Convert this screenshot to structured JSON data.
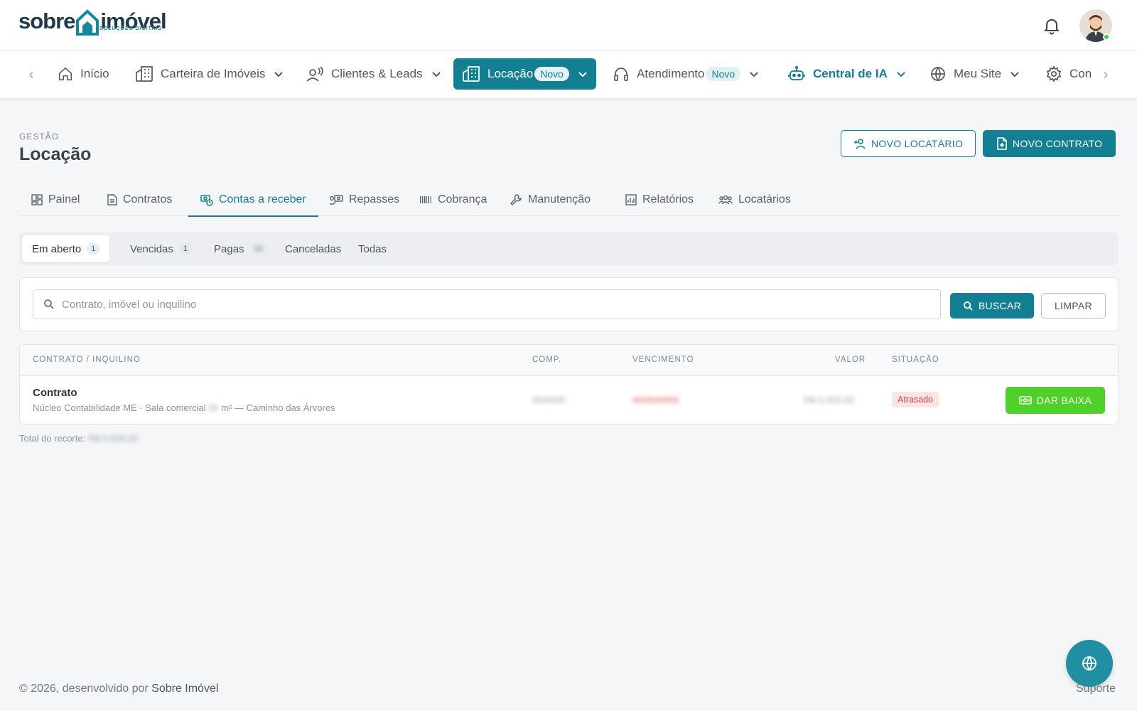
{
  "brand": {
    "name_left": "sobre",
    "name_right": "imóvel",
    "tagline": "SOLUÇÕES DIGITAIS",
    "primary_color": "#137f92",
    "success_color": "#4fd12a",
    "danger_color": "#d64545"
  },
  "header": {
    "notifications_icon": "bell-icon",
    "avatar_alt": "user-avatar"
  },
  "nav": {
    "items": [
      {
        "label": "Início",
        "icon": "home-icon"
      },
      {
        "label": "Carteira de Imóveis",
        "icon": "building-icon"
      },
      {
        "label": "Clientes & Leads",
        "icon": "people-icon"
      },
      {
        "label": "Locação",
        "badge": "Novo",
        "icon": "building-icon"
      },
      {
        "label": "Atendimento",
        "badge": "Novo",
        "icon": "headset-icon"
      },
      {
        "label": "Central de IA",
        "icon": "robot-icon"
      },
      {
        "label": "Meu Site",
        "icon": "globe-icon"
      },
      {
        "label": "Con",
        "icon": "gear-icon"
      }
    ]
  },
  "page": {
    "eyebrow": "GESTÃO",
    "title": "Locação",
    "btn_new_tenant": "NOVO LOCATÁRIO",
    "btn_new_contract": "NOVO CONTRATO"
  },
  "tabs": [
    {
      "label": "Painel"
    },
    {
      "label": "Contratos"
    },
    {
      "label": "Contas a receber"
    },
    {
      "label": "Repasses"
    },
    {
      "label": "Cobrança"
    },
    {
      "label": "Manutenção"
    },
    {
      "label": "Relatórios"
    },
    {
      "label": "Locatários"
    }
  ],
  "filters": [
    {
      "label": "Em aberto",
      "count": "1"
    },
    {
      "label": "Vencidas",
      "count": "1"
    },
    {
      "label": "Pagas",
      "count": "10"
    },
    {
      "label": "Canceladas"
    },
    {
      "label": "Todas"
    }
  ],
  "search": {
    "placeholder": "Contrato, imóvel ou inquilino",
    "value": "",
    "btn_search": "BUSCAR",
    "btn_clear": "LIMPAR"
  },
  "table": {
    "columns": {
      "contract": "CONTRATO / INQUILINO",
      "comp": "COMP.",
      "due": "VENCIMENTO",
      "value": "VALOR",
      "status": "SITUAÇÃO"
    },
    "rows": [
      {
        "title": "Contrato",
        "sub_prefix": "Núcleo Contabilidade ME · Sala comercial ",
        "sub_area": "00",
        "sub_suffix": " m² — Caminho das Árvores",
        "comp": "00/0000",
        "due": "00/00/0000",
        "value": "R$ 0.000,00",
        "status": "Atrasado",
        "action": "DAR BAIXA"
      }
    ]
  },
  "total": {
    "label": "Total do recorte: ",
    "value": "R$ 0.000,00"
  },
  "footer": {
    "prefix": "© 2026, desenvolvido por ",
    "brand": "Sobre Imóvel",
    "support": "Suporte"
  }
}
